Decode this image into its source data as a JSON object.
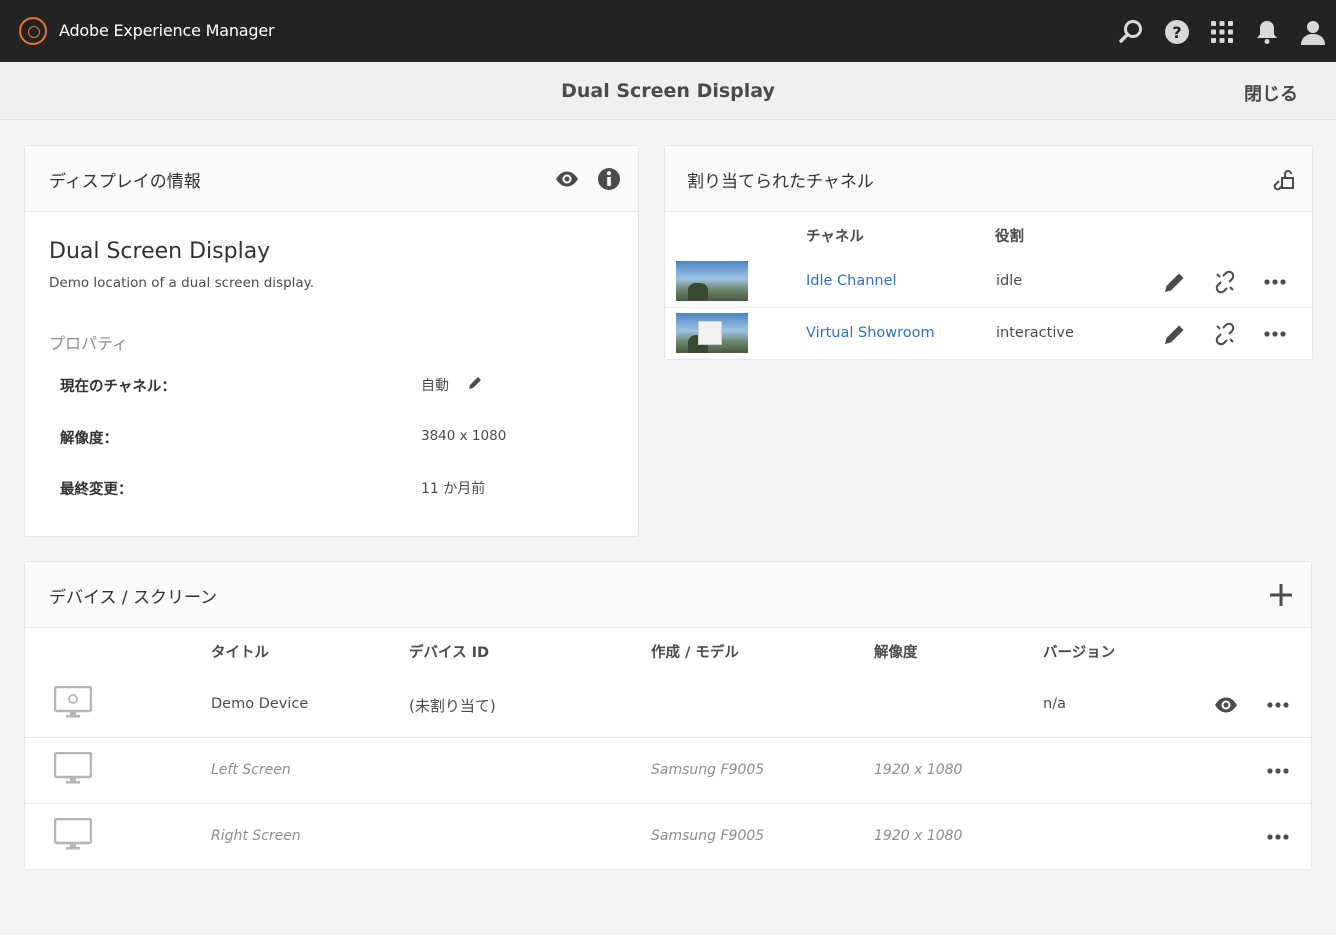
{
  "shell": {
    "brand": "Adobe Experience Manager",
    "icons": [
      "search-icon",
      "help-icon",
      "apps-grid-icon",
      "bell-icon",
      "user-icon"
    ],
    "accent_color": "#e8722c"
  },
  "titlebar": {
    "title": "Dual Screen Display",
    "close_label": "閉じる"
  },
  "info": {
    "heading": "ディスプレイの情報",
    "name": "Dual Screen Display",
    "description": "Demo location of a dual screen display.",
    "properties_heading": "プロパティ",
    "properties": [
      {
        "label": "現在のチャネル：",
        "value": "自動"
      },
      {
        "label": "解像度：",
        "value": "3840 x 1080"
      },
      {
        "label": "最終変更：",
        "value": "11 か月前"
      }
    ]
  },
  "channels": {
    "heading": "割り当てられたチャネル",
    "columns": {
      "channel": "チャネル",
      "role": "役割"
    },
    "rows": [
      {
        "name": "Idle Channel",
        "role": "idle"
      },
      {
        "name": "Virtual Showroom",
        "role": "interactive"
      }
    ],
    "link_color": "#2d74c5"
  },
  "devices": {
    "heading": "デバイス / スクリーン",
    "columns": {
      "title": "タイトル",
      "device_id": "デバイス ID",
      "make_model": "作成 / モデル",
      "resolution": "解像度",
      "version": "バージョン"
    },
    "rows": [
      {
        "title": "Demo Device",
        "device_id": "(未割り当て)",
        "model": "",
        "resolution": "",
        "version": "n/a"
      },
      {
        "title": "Left Screen",
        "device_id": "",
        "model": "Samsung F9005",
        "resolution": "1920 x 1080",
        "version": ""
      },
      {
        "title": "Right Screen",
        "device_id": "",
        "model": "Samsung F9005",
        "resolution": "1920 x 1080",
        "version": ""
      }
    ]
  }
}
